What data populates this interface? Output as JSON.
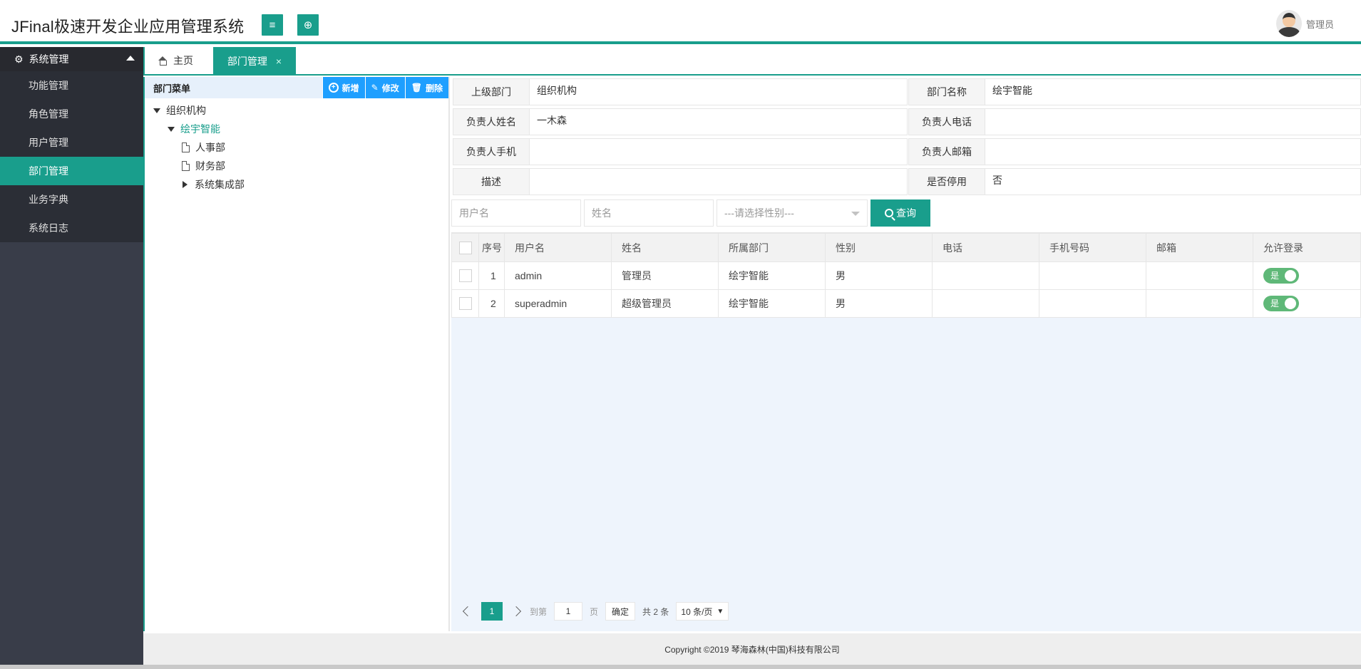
{
  "header": {
    "title": "JFinal极速开发企业应用管理系统",
    "menu_icon": "≡",
    "globe_icon": "⊕",
    "user_name": "管理员"
  },
  "sidebar": {
    "group_title": "系统管理",
    "items": [
      {
        "label": "功能管理"
      },
      {
        "label": "角色管理"
      },
      {
        "label": "用户管理"
      },
      {
        "label": "部门管理",
        "active": true
      },
      {
        "label": "业务字典"
      },
      {
        "label": "系统日志"
      }
    ]
  },
  "tabs": {
    "home": "主页",
    "active": "部门管理",
    "close": "×"
  },
  "tree": {
    "title": "部门菜单",
    "buttons": {
      "add": "新增",
      "edit": "修改",
      "delete": "删除"
    },
    "root": "组织机构",
    "child": "绘宇智能",
    "leaves": [
      "人事部",
      "财务部"
    ],
    "collapsed": "系统集成部"
  },
  "form": {
    "parent_label": "上级部门",
    "parent_value": "组织机构",
    "name_label": "部门名称",
    "name_value": "绘宇智能",
    "leader_label": "负责人姓名",
    "leader_value": "一木森",
    "phone_label": "负责人电话",
    "phone_value": "",
    "mobile_label": "负责人手机",
    "mobile_value": "",
    "email_label": "负责人邮箱",
    "email_value": "",
    "desc_label": "描述",
    "desc_value": "",
    "disabled_label": "是否停用",
    "disabled_value": "否"
  },
  "search": {
    "username_placeholder": "用户名",
    "name_placeholder": "姓名",
    "gender_placeholder": "---请选择性别---",
    "query_label": "查询"
  },
  "table": {
    "columns": [
      "序号",
      "用户名",
      "姓名",
      "所属部门",
      "性别",
      "电话",
      "手机号码",
      "邮箱",
      "允许登录"
    ],
    "rows": [
      {
        "index": "1",
        "username": "admin",
        "name": "管理员",
        "dept": "绘宇智能",
        "gender": "男",
        "phone": "",
        "mobile": "",
        "email": "",
        "login": "是"
      },
      {
        "index": "2",
        "username": "superadmin",
        "name": "超级管理员",
        "dept": "绘宇智能",
        "gender": "男",
        "phone": "",
        "mobile": "",
        "email": "",
        "login": "是"
      }
    ]
  },
  "pager": {
    "current": "1",
    "goto_label": "到第",
    "goto_value": "1",
    "page_unit": "页",
    "confirm": "确定",
    "total": "共 2 条",
    "page_size": "10 条/页",
    "size_arrow": "▼"
  },
  "footer": {
    "copyright": "Copyright ©2019 琴海森林(中国)科技有限公司"
  },
  "colors": {
    "accent": "#199e8c",
    "sidebar": "#393d49",
    "blue_button": "#1e9fff",
    "switch_on": "#5fb878"
  }
}
